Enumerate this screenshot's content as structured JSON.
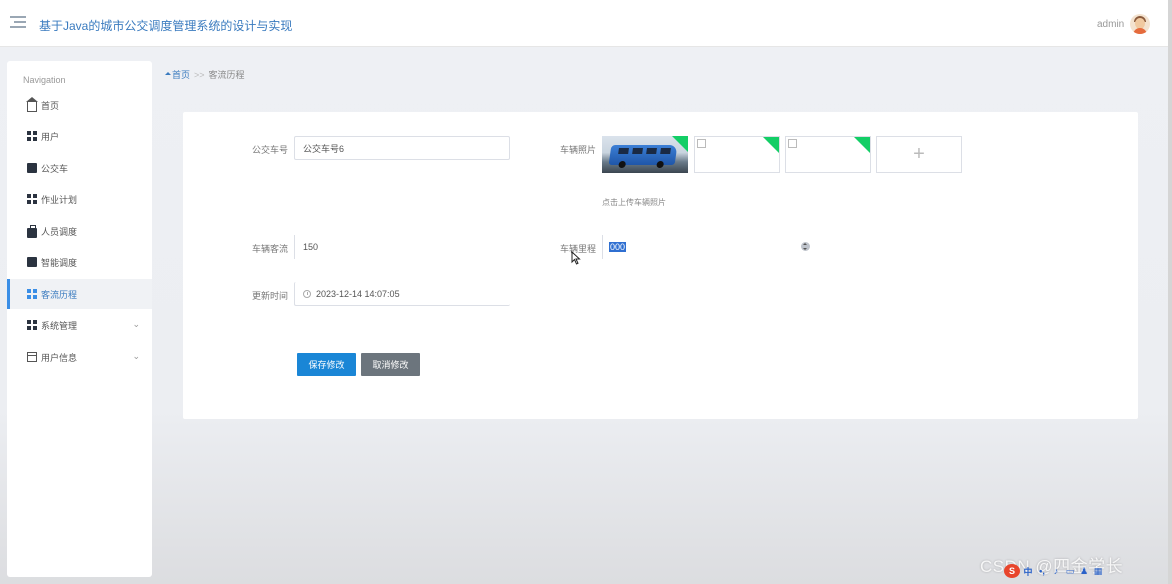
{
  "header": {
    "title": "基于Java的城市公交调度管理系统的设计与实现",
    "user": "admin"
  },
  "sidebar": {
    "heading": "Navigation",
    "items": [
      {
        "label": "首页"
      },
      {
        "label": "用户"
      },
      {
        "label": "公交车"
      },
      {
        "label": "作业计划"
      },
      {
        "label": "人员调度"
      },
      {
        "label": "智能调度"
      },
      {
        "label": "客流历程"
      },
      {
        "label": "系统管理"
      },
      {
        "label": "用户信息"
      }
    ]
  },
  "breadcrumb": {
    "home": "首页",
    "separator": ">>",
    "current": "客流历程"
  },
  "form": {
    "bus_no_label": "公交车号",
    "bus_no_value": "公交车号6",
    "photo_label": "车辆照片",
    "photo_hint": "点击上传车辆照片",
    "flow_label": "车辆客流",
    "flow_value": "150",
    "mileage_label": "车辆里程",
    "mileage_value": "000",
    "update_label": "更新时间",
    "update_value": "2023-12-14 14:07:05",
    "upload_plus": "+",
    "save_button": "保存修改",
    "cancel_button": "取消修改"
  },
  "watermark": "CSDN @四金学长",
  "tray": [
    "S",
    "中",
    "•,",
    "♪",
    "▭",
    "♟",
    "▦"
  ],
  "colors": {
    "accent": "#1a86d6",
    "title": "#3a7bbf",
    "secondary_button": "#6c757d",
    "upload_corner": "#13ce66"
  }
}
